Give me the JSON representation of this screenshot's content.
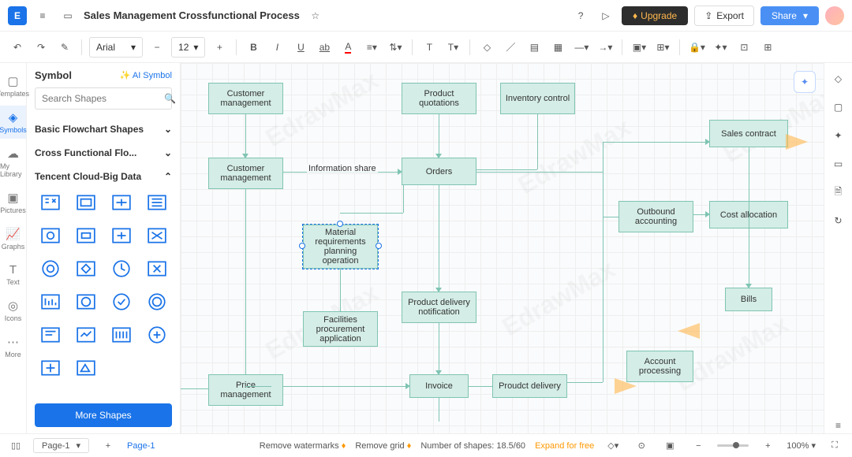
{
  "header": {
    "title": "Sales Management Crossfunctional Process",
    "upgrade": "Upgrade",
    "export": "Export",
    "share": "Share"
  },
  "toolbar": {
    "font": "Arial",
    "size": "12"
  },
  "leftTools": [
    "Templates",
    "Symbols",
    "My Library",
    "Pictures",
    "Graphs",
    "Text",
    "Icons",
    "More"
  ],
  "sidebar": {
    "title": "Symbol",
    "ai": "AI Symbol",
    "search_ph": "Search Shapes",
    "cat1": "Basic Flowchart Shapes",
    "cat2": "Cross Functional Flo...",
    "cat3": "Tencent Cloud-Big Data",
    "more": "More Shapes"
  },
  "nodes": {
    "n1": "Customer management",
    "n2": "Product quotations",
    "n3": "Inventory control",
    "n4": "Customer management",
    "n5": "Orders",
    "n6": "Sales contract",
    "n7": "Material requirements planning operation",
    "n8": "Outbound accounting",
    "n9": "Cost allocation",
    "n10": "Product delivery notification",
    "n11": "Facilities procurement application",
    "n12": "Bills",
    "n13": "Price management",
    "n14": "Invoice",
    "n15": "Proudct delivery",
    "n16": "Account processing",
    "edge1": "Information share"
  },
  "status": {
    "page": "Page-1",
    "page2": "Page-1",
    "wm": "Remove watermarks",
    "grid": "Remove grid",
    "shapes": "Number of shapes: 18.5/60",
    "expand": "Expand for free",
    "zoom": "100%"
  }
}
